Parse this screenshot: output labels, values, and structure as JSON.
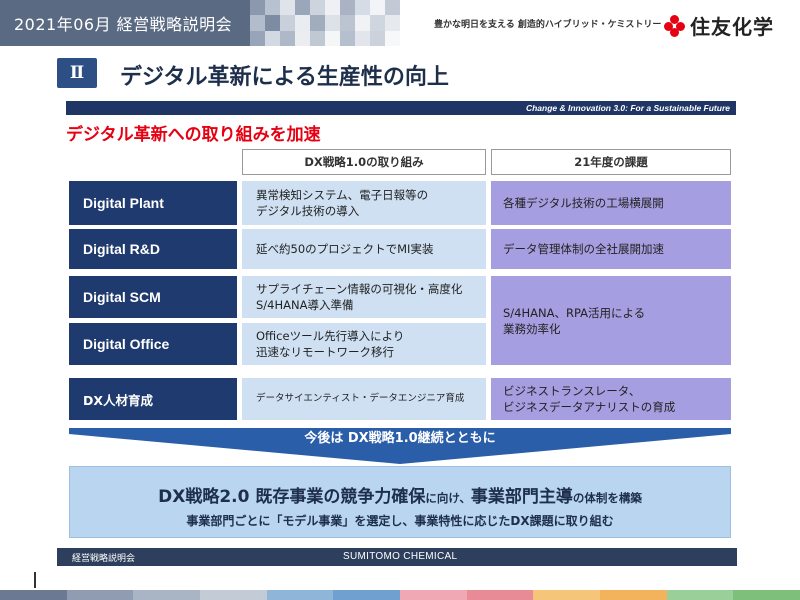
{
  "header": {
    "date_title": "2021年06月 経営戦略説明会",
    "tagline": "豊かな明日を支える 創造的ハイブリッド・ケミストリー",
    "logo_text": "住友化学",
    "mosaic_colors": [
      "#8b98ad",
      "#b8c1cf",
      "#dfe3ea",
      "#9aa6ba",
      "#cdd4de",
      "#eef0f4",
      "#a9b3c4",
      "#d6dce5",
      "#f2f4f7",
      "#c3cad6",
      "#b3bccb",
      "#7d8ba3",
      "#c9d0db",
      "#e9ecf1",
      "#a1acbf",
      "#dde2e9",
      "#bcc4d1",
      "#f0f2f5",
      "#d0d6df",
      "#e6e9ee",
      "#98a4b8",
      "#d3d9e2",
      "#aeb8c8",
      "#ebedf1",
      "#c0c8d4",
      "#f5f6f8",
      "#b6bfcd",
      "#e2e6ec",
      "#ccd2dc",
      "#f7f8fa"
    ]
  },
  "section": {
    "number": "Ⅱ",
    "title": "デジタル革新による生産性の向上"
  },
  "banner": "Change & Innovation 3.0: For a Sustainable Future",
  "subtitle": "デジタル革新への取り組みを加速",
  "table": {
    "col_headers": [
      "DX戦略1.0の取り組み",
      "21年度の課題"
    ],
    "rows": [
      {
        "label": "Digital Plant",
        "mid": "異常検知システム、電子日報等の\nデジタル技術の導入",
        "right": "各種デジタル技術の工場横展開"
      },
      {
        "label": "Digital R&D",
        "mid": "延べ約50のプロジェクトでMI実装",
        "right": "データ管理体制の全社展開加速"
      },
      {
        "label": "Digital SCM",
        "mid": "サプライチェーン情報の可視化・高度化\nS/4HANA導入準備",
        "right": "S/4HANA、RPA活用による\n業務効率化"
      },
      {
        "label": "Digital Office",
        "mid": "Officeツール先行導入により\n迅速なリモートワーク移行",
        "right": ""
      },
      {
        "label": "DX人材育成",
        "mid": "データサイエンティスト・データエンジニア育成",
        "right": "ビジネストランスレータ、\nビジネスデータアナリストの育成"
      }
    ]
  },
  "arrow_text": "今後は DX戦略1.0継続とともに",
  "bottom": {
    "l1_a": "DX戦略2.0 既存事業の競争力確保",
    "l1_b": "に向け、",
    "l1_c": "事業部門主導",
    "l1_d": "の体制を構築",
    "l2": "事業部門ごとに「モデル事業」を選定し、事業特性に応じたDX課題に取り組む"
  },
  "footer": {
    "left": "経営戦略説明会",
    "center": "SUMITOMO CHEMICAL",
    "strip_colors": [
      "#6b7a92",
      "#8f9cb1",
      "#a9b4c5",
      "#c3cbd7",
      "#8fb5d9",
      "#6fa0cf",
      "#f0a8b4",
      "#e98a97",
      "#f5c67a",
      "#f2b35c",
      "#9bcf9a",
      "#7dbf7b"
    ]
  },
  "colors": {
    "navy": "#1e3a6e",
    "light_blue": "#cfe0f3",
    "lavender": "#a59ee0",
    "accent_red": "#e60012",
    "bottom_box": "#b9d5f0"
  }
}
